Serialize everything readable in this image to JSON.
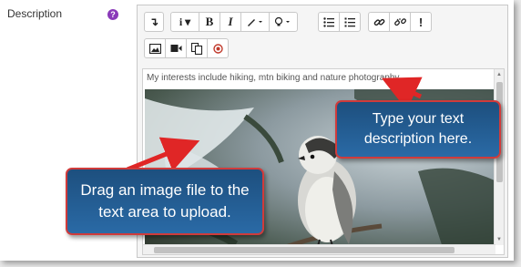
{
  "form": {
    "field_label": "Description",
    "help_icon": "question-circle-icon"
  },
  "toolbar": {
    "row1": [
      {
        "name": "collapse-button",
        "icon": "expand-arrow-icon",
        "glyph": "↴"
      },
      {
        "name": "paragraph-style-button",
        "icon": "info-dropdown-icon",
        "glyph": "i ▾"
      },
      {
        "name": "bold-button",
        "icon": "bold-icon",
        "glyph": "B"
      },
      {
        "name": "italic-button",
        "icon": "italic-icon",
        "glyph": "I"
      },
      {
        "name": "text-color-button",
        "icon": "brush-icon",
        "glyph": "✎▾"
      },
      {
        "name": "background-color-button",
        "icon": "lightbulb-icon",
        "glyph": "💡▾"
      },
      {
        "name": "unordered-list-button",
        "icon": "bullet-list-icon",
        "glyph": "☰"
      },
      {
        "name": "ordered-list-button",
        "icon": "numbered-list-icon",
        "glyph": "☷"
      },
      {
        "name": "link-button",
        "icon": "link-icon",
        "glyph": "🔗"
      },
      {
        "name": "unlink-button",
        "icon": "unlink-icon",
        "glyph": "⛓"
      },
      {
        "name": "accessibility-check-button",
        "icon": "exclamation-icon",
        "glyph": "!"
      }
    ],
    "row2": [
      {
        "name": "insert-image-button",
        "icon": "image-icon",
        "glyph": "▣"
      },
      {
        "name": "insert-media-button",
        "icon": "video-camera-icon",
        "glyph": "■"
      },
      {
        "name": "manage-files-button",
        "icon": "copy-files-icon",
        "glyph": "⧉"
      },
      {
        "name": "recordrtc-button",
        "icon": "record-icon",
        "glyph": "◎"
      }
    ]
  },
  "content": {
    "text": "My interests include hiking, mtn biking and nature photography",
    "image": "bird-on-branch-photo"
  },
  "callouts": {
    "type_text": "Type your text description here.",
    "drag_image": "Drag an image file to the text area to upload."
  },
  "colors": {
    "help": "#8a3ab9",
    "callout_bg": "#2a6aa6",
    "callout_border": "#d03b3b",
    "arrow": "#e02626"
  }
}
